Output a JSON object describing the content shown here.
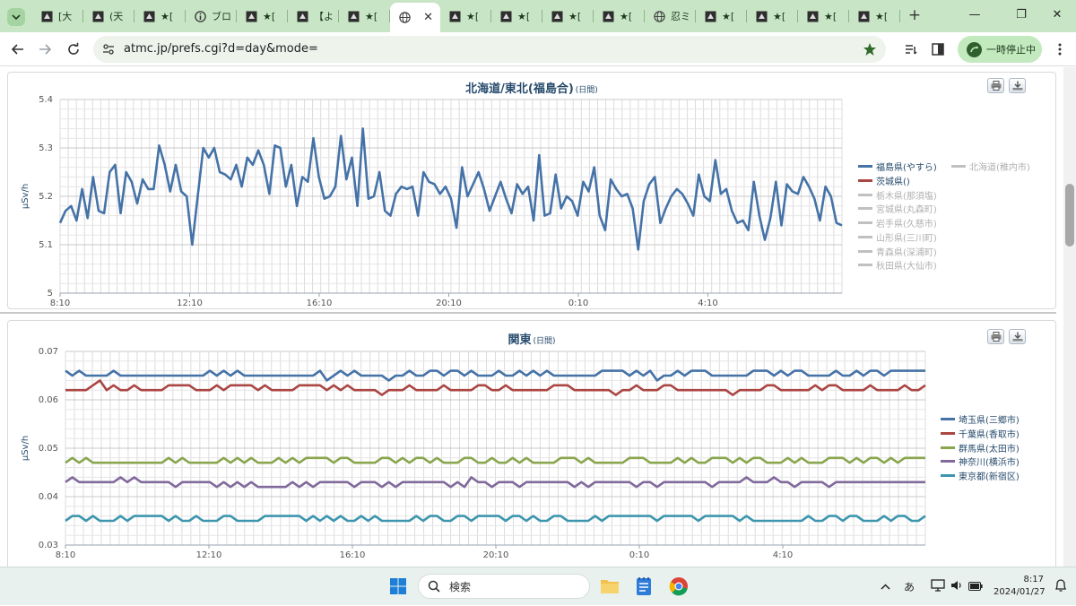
{
  "browser": {
    "tabs": [
      {
        "label": "[大",
        "icon": "site-icon"
      },
      {
        "label": "(天",
        "icon": "site-icon"
      },
      {
        "label": "★[",
        "icon": "site-icon"
      },
      {
        "label": "ブロ",
        "icon": "info-icon"
      },
      {
        "label": "★[",
        "icon": "site-icon"
      },
      {
        "label": "【よ",
        "icon": "site-icon"
      },
      {
        "label": "★[",
        "icon": "site-icon"
      },
      {
        "label": "",
        "icon": "globe-icon",
        "active": true
      },
      {
        "label": "★[",
        "icon": "site-icon"
      },
      {
        "label": "★[",
        "icon": "site-icon"
      },
      {
        "label": "★[",
        "icon": "site-icon"
      },
      {
        "label": "★[",
        "icon": "site-icon"
      },
      {
        "label": "忍ミ",
        "icon": "globe-icon"
      },
      {
        "label": "★[",
        "icon": "site-icon"
      },
      {
        "label": "★[",
        "icon": "site-icon"
      },
      {
        "label": "★[",
        "icon": "site-icon"
      },
      {
        "label": "★[",
        "icon": "site-icon"
      }
    ],
    "url": "atmc.jp/prefs.cgi?d=day&mode=",
    "pause_label": "一時停止中"
  },
  "charts": [
    {
      "title": "北海道/東北(福島合)",
      "subtitle": "(日間)",
      "ylabel": "μSv/h",
      "yticks": [
        "5.4",
        "5.3",
        "5.2",
        "5.1",
        "5"
      ],
      "xticks": [
        "8:10",
        "12:10",
        "16:10",
        "20:10",
        "0:10",
        "4:10"
      ],
      "legend": [
        {
          "name": "福島県(やすら)",
          "color": "#4572a7",
          "active": true
        },
        {
          "name": "北海道(稚内市)",
          "color": "#c0c0c0",
          "active": false
        },
        {
          "name": "茨城県()",
          "color": "#aa4643",
          "active": true
        },
        {
          "name": "栃木県(那須塩)",
          "color": "#c0c0c0",
          "active": false
        },
        {
          "name": "宮城県(丸森町)",
          "color": "#c0c0c0",
          "active": false
        },
        {
          "name": "岩手県(久慈市)",
          "color": "#c0c0c0",
          "active": false
        },
        {
          "name": "山形県(三川町)",
          "color": "#c0c0c0",
          "active": false
        },
        {
          "name": "青森県(深浦町)",
          "color": "#c0c0c0",
          "active": false
        },
        {
          "name": "秋田県(大仙市)",
          "color": "#c0c0c0",
          "active": false
        }
      ]
    },
    {
      "title": "関東",
      "subtitle": "(日間)",
      "ylabel": "μSv/h",
      "yticks": [
        "0.07",
        "0.06",
        "0.05",
        "0.04",
        "0.03"
      ],
      "xticks": [
        "8:10",
        "12:10",
        "16:10",
        "20:10",
        "0:10",
        "4:10"
      ],
      "legend": [
        {
          "name": "埼玉県(三郷市)",
          "color": "#4572a7",
          "active": true
        },
        {
          "name": "千葉県(香取市)",
          "color": "#aa4643",
          "active": true
        },
        {
          "name": "群馬県(太田市)",
          "color": "#89a54e",
          "active": true
        },
        {
          "name": "神奈川(横浜市)",
          "color": "#80699b",
          "active": true
        },
        {
          "name": "東京都(新宿区)",
          "color": "#3d96ae",
          "active": true
        }
      ]
    }
  ],
  "chart_data": [
    {
      "type": "line",
      "title": "北海道/東北(福島合)",
      "subtitle": "(日間)",
      "ylabel": "μSv/h",
      "ylim": [
        5.0,
        5.4
      ],
      "x_range": [
        "8:10",
        "7:00"
      ],
      "x_ticks": [
        "8:10",
        "12:10",
        "16:10",
        "20:10",
        "0:10",
        "4:10"
      ],
      "grid": true,
      "legend_position": "right",
      "series": [
        {
          "name": "福島県(やすら)",
          "color": "#4572a7",
          "values": [
            5.145,
            5.17,
            5.18,
            5.15,
            5.215,
            5.155,
            5.24,
            5.17,
            5.165,
            5.25,
            5.265,
            5.165,
            5.25,
            5.23,
            5.185,
            5.235,
            5.215,
            5.215,
            5.305,
            5.265,
            5.21,
            5.265,
            5.21,
            5.2,
            5.1,
            5.2,
            5.3,
            5.28,
            5.3,
            5.25,
            5.245,
            5.235,
            5.265,
            5.22,
            5.28,
            5.265,
            5.295,
            5.265,
            5.205,
            5.305,
            5.3,
            5.22,
            5.265,
            5.18,
            5.24,
            5.23,
            5.32,
            5.24,
            5.195,
            5.2,
            5.22,
            5.325,
            5.235,
            5.28,
            5.18,
            5.34,
            5.195,
            5.2,
            5.25,
            5.17,
            5.16,
            5.205,
            5.22,
            5.215,
            5.22,
            5.16,
            5.25,
            5.23,
            5.225,
            5.205,
            5.22,
            5.195,
            5.135,
            5.26,
            5.2,
            5.225,
            5.25,
            5.215,
            5.17,
            5.2,
            5.23,
            5.195,
            5.165,
            5.225,
            5.205,
            5.22,
            5.15,
            5.285,
            5.16,
            5.165,
            5.245,
            5.175,
            5.2,
            5.19,
            5.16,
            5.23,
            5.21,
            5.26,
            5.16,
            5.13,
            5.235,
            5.215,
            5.2,
            5.205,
            5.175,
            5.09,
            5.19,
            5.225,
            5.24,
            5.145,
            5.175,
            5.2,
            5.215,
            5.205,
            5.185,
            5.16,
            5.245,
            5.2,
            5.19,
            5.275,
            5.205,
            5.215,
            5.17,
            5.145,
            5.15,
            5.13,
            5.23,
            5.16,
            5.11,
            5.155,
            5.23,
            5.14,
            5.225,
            5.21,
            5.205,
            5.24,
            5.22,
            5.195,
            5.15,
            5.22,
            5.2,
            5.145,
            5.14
          ]
        }
      ]
    },
    {
      "type": "line",
      "title": "関東",
      "subtitle": "(日間)",
      "ylabel": "μSv/h",
      "ylim": [
        0.03,
        0.07
      ],
      "x_range": [
        "8:10",
        "7:00"
      ],
      "x_ticks": [
        "8:10",
        "12:10",
        "16:10",
        "20:10",
        "0:10",
        "4:10"
      ],
      "grid": true,
      "legend_position": "right",
      "series": [
        {
          "name": "埼玉県(三郷市)",
          "color": "#4572a7",
          "values": [
            0.066,
            0.065,
            0.066,
            0.065,
            0.065,
            0.065,
            0.065,
            0.066,
            0.065,
            0.065,
            0.065,
            0.065,
            0.065,
            0.065,
            0.065,
            0.065,
            0.065,
            0.065,
            0.065,
            0.065,
            0.065,
            0.066,
            0.065,
            0.066,
            0.065,
            0.066,
            0.065,
            0.065,
            0.065,
            0.065,
            0.065,
            0.065,
            0.065,
            0.065,
            0.065,
            0.065,
            0.065,
            0.066,
            0.064,
            0.065,
            0.066,
            0.065,
            0.066,
            0.065,
            0.065,
            0.065,
            0.065,
            0.064,
            0.065,
            0.065,
            0.066,
            0.065,
            0.065,
            0.066,
            0.066,
            0.065,
            0.066,
            0.066,
            0.065,
            0.066,
            0.065,
            0.065,
            0.065,
            0.066,
            0.065,
            0.065,
            0.066,
            0.065,
            0.066,
            0.065,
            0.066,
            0.065,
            0.065,
            0.065,
            0.065,
            0.065,
            0.065,
            0.065,
            0.066,
            0.066,
            0.066,
            0.066,
            0.065,
            0.066,
            0.065,
            0.066,
            0.064,
            0.065,
            0.065,
            0.066,
            0.065,
            0.066,
            0.066,
            0.066,
            0.065,
            0.065,
            0.065,
            0.065,
            0.065,
            0.065,
            0.066,
            0.066,
            0.066,
            0.065,
            0.066,
            0.065,
            0.066,
            0.066,
            0.065,
            0.065,
            0.065,
            0.065,
            0.066,
            0.065,
            0.065,
            0.066,
            0.065,
            0.066,
            0.066,
            0.065,
            0.066,
            0.066,
            0.066,
            0.066,
            0.066,
            0.066
          ]
        },
        {
          "name": "千葉県(香取市)",
          "color": "#aa4643",
          "values": [
            0.062,
            0.062,
            0.062,
            0.062,
            0.063,
            0.064,
            0.062,
            0.063,
            0.062,
            0.062,
            0.063,
            0.062,
            0.062,
            0.062,
            0.062,
            0.063,
            0.063,
            0.063,
            0.063,
            0.062,
            0.062,
            0.062,
            0.063,
            0.062,
            0.063,
            0.063,
            0.063,
            0.063,
            0.062,
            0.063,
            0.062,
            0.062,
            0.062,
            0.062,
            0.063,
            0.063,
            0.063,
            0.063,
            0.062,
            0.063,
            0.062,
            0.063,
            0.062,
            0.062,
            0.062,
            0.062,
            0.061,
            0.062,
            0.062,
            0.062,
            0.063,
            0.062,
            0.062,
            0.062,
            0.062,
            0.063,
            0.062,
            0.062,
            0.062,
            0.062,
            0.063,
            0.063,
            0.062,
            0.062,
            0.063,
            0.062,
            0.062,
            0.062,
            0.062,
            0.062,
            0.062,
            0.063,
            0.063,
            0.063,
            0.062,
            0.062,
            0.062,
            0.062,
            0.062,
            0.062,
            0.061,
            0.062,
            0.062,
            0.063,
            0.062,
            0.062,
            0.062,
            0.063,
            0.063,
            0.062,
            0.062,
            0.062,
            0.062,
            0.062,
            0.062,
            0.062,
            0.062,
            0.061,
            0.062,
            0.062,
            0.062,
            0.062,
            0.063,
            0.063,
            0.062,
            0.062,
            0.062,
            0.062,
            0.062,
            0.063,
            0.062,
            0.063,
            0.063,
            0.062,
            0.062,
            0.062,
            0.062,
            0.063,
            0.062,
            0.062,
            0.062,
            0.062,
            0.063,
            0.062,
            0.062,
            0.063
          ]
        },
        {
          "name": "群馬県(太田市)",
          "color": "#89a54e",
          "values": [
            0.047,
            0.048,
            0.047,
            0.048,
            0.047,
            0.047,
            0.047,
            0.047,
            0.047,
            0.047,
            0.047,
            0.047,
            0.047,
            0.047,
            0.047,
            0.048,
            0.047,
            0.048,
            0.047,
            0.047,
            0.047,
            0.047,
            0.047,
            0.048,
            0.047,
            0.048,
            0.047,
            0.048,
            0.047,
            0.047,
            0.047,
            0.048,
            0.047,
            0.048,
            0.047,
            0.048,
            0.048,
            0.048,
            0.048,
            0.047,
            0.048,
            0.048,
            0.047,
            0.047,
            0.047,
            0.047,
            0.048,
            0.048,
            0.047,
            0.048,
            0.047,
            0.048,
            0.048,
            0.047,
            0.048,
            0.047,
            0.047,
            0.047,
            0.048,
            0.048,
            0.047,
            0.047,
            0.048,
            0.047,
            0.047,
            0.048,
            0.047,
            0.048,
            0.047,
            0.047,
            0.047,
            0.047,
            0.048,
            0.048,
            0.048,
            0.047,
            0.048,
            0.047,
            0.047,
            0.047,
            0.047,
            0.047,
            0.048,
            0.048,
            0.048,
            0.047,
            0.047,
            0.047,
            0.047,
            0.048,
            0.047,
            0.048,
            0.047,
            0.047,
            0.048,
            0.048,
            0.048,
            0.047,
            0.048,
            0.047,
            0.048,
            0.048,
            0.047,
            0.047,
            0.047,
            0.048,
            0.047,
            0.048,
            0.047,
            0.047,
            0.047,
            0.048,
            0.048,
            0.048,
            0.047,
            0.048,
            0.047,
            0.048,
            0.048,
            0.047,
            0.048,
            0.047,
            0.048,
            0.048,
            0.048,
            0.048
          ]
        },
        {
          "name": "神奈川(横浜市)",
          "color": "#80699b",
          "values": [
            0.043,
            0.044,
            0.043,
            0.043,
            0.043,
            0.043,
            0.043,
            0.043,
            0.044,
            0.043,
            0.044,
            0.043,
            0.043,
            0.043,
            0.043,
            0.043,
            0.042,
            0.043,
            0.043,
            0.043,
            0.043,
            0.043,
            0.042,
            0.043,
            0.042,
            0.043,
            0.042,
            0.043,
            0.042,
            0.042,
            0.042,
            0.042,
            0.042,
            0.043,
            0.042,
            0.043,
            0.042,
            0.043,
            0.043,
            0.043,
            0.043,
            0.043,
            0.042,
            0.043,
            0.043,
            0.043,
            0.042,
            0.043,
            0.042,
            0.043,
            0.043,
            0.043,
            0.043,
            0.043,
            0.043,
            0.043,
            0.042,
            0.043,
            0.042,
            0.044,
            0.043,
            0.043,
            0.042,
            0.043,
            0.043,
            0.043,
            0.042,
            0.043,
            0.043,
            0.043,
            0.043,
            0.043,
            0.043,
            0.043,
            0.042,
            0.043,
            0.042,
            0.043,
            0.043,
            0.043,
            0.043,
            0.043,
            0.043,
            0.042,
            0.043,
            0.043,
            0.042,
            0.043,
            0.043,
            0.043,
            0.043,
            0.043,
            0.043,
            0.043,
            0.042,
            0.043,
            0.043,
            0.043,
            0.043,
            0.044,
            0.043,
            0.043,
            0.043,
            0.044,
            0.043,
            0.043,
            0.042,
            0.043,
            0.043,
            0.043,
            0.043,
            0.042,
            0.043,
            0.043,
            0.043,
            0.043,
            0.043,
            0.043,
            0.043,
            0.043,
            0.043,
            0.043,
            0.043,
            0.043,
            0.043,
            0.043
          ]
        },
        {
          "name": "東京都(新宿区)",
          "color": "#3d96ae",
          "values": [
            0.035,
            0.036,
            0.036,
            0.035,
            0.036,
            0.035,
            0.035,
            0.035,
            0.036,
            0.035,
            0.036,
            0.036,
            0.036,
            0.036,
            0.036,
            0.035,
            0.036,
            0.035,
            0.035,
            0.036,
            0.035,
            0.035,
            0.035,
            0.036,
            0.036,
            0.035,
            0.035,
            0.035,
            0.035,
            0.036,
            0.036,
            0.036,
            0.036,
            0.036,
            0.036,
            0.035,
            0.036,
            0.035,
            0.036,
            0.035,
            0.036,
            0.035,
            0.035,
            0.036,
            0.035,
            0.036,
            0.035,
            0.035,
            0.035,
            0.035,
            0.035,
            0.036,
            0.035,
            0.036,
            0.036,
            0.035,
            0.035,
            0.036,
            0.036,
            0.035,
            0.036,
            0.036,
            0.036,
            0.036,
            0.035,
            0.036,
            0.036,
            0.035,
            0.036,
            0.035,
            0.035,
            0.036,
            0.036,
            0.035,
            0.035,
            0.035,
            0.035,
            0.036,
            0.035,
            0.036,
            0.036,
            0.036,
            0.036,
            0.036,
            0.036,
            0.036,
            0.035,
            0.036,
            0.036,
            0.036,
            0.036,
            0.036,
            0.035,
            0.036,
            0.036,
            0.036,
            0.036,
            0.036,
            0.035,
            0.036,
            0.035,
            0.035,
            0.035,
            0.035,
            0.035,
            0.035,
            0.035,
            0.035,
            0.036,
            0.035,
            0.035,
            0.036,
            0.036,
            0.035,
            0.036,
            0.036,
            0.035,
            0.035,
            0.035,
            0.036,
            0.035,
            0.036,
            0.036,
            0.035,
            0.035,
            0.036
          ]
        }
      ]
    }
  ],
  "taskbar": {
    "search_placeholder": "検索",
    "ime": "あ",
    "time": "8:17",
    "date": "2024/01/27"
  }
}
